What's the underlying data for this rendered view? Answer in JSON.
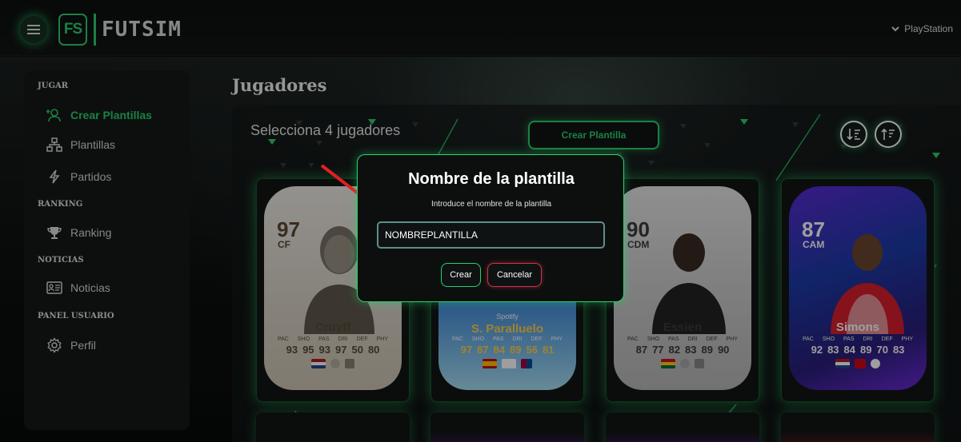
{
  "header": {
    "logo_mark": "FS",
    "app_name": "FUTSIM",
    "platform": "PlayStation"
  },
  "sidebar": {
    "sections": [
      {
        "title": "JUGAR",
        "items": [
          {
            "label": "Crear Plantillas",
            "icon": "add-user-icon",
            "active": true
          },
          {
            "label": "Plantillas",
            "icon": "hierarchy-icon"
          },
          {
            "label": "Partidos",
            "icon": "lightning-icon"
          }
        ]
      },
      {
        "title": "RANKING",
        "items": [
          {
            "label": "Ranking",
            "icon": "trophy-icon"
          }
        ]
      },
      {
        "title": "NOTICIAS",
        "items": [
          {
            "label": "Noticias",
            "icon": "news-icon"
          }
        ]
      },
      {
        "title": "PANEL USUARIO",
        "items": [
          {
            "label": "Perfil",
            "icon": "gear-icon"
          }
        ]
      }
    ]
  },
  "main": {
    "title": "Jugadores",
    "select_label": "Selecciona 4 jugadores",
    "create_button": "Crear Plantilla",
    "sort_icons": [
      "sort-desc-icon",
      "sort-asc-icon"
    ]
  },
  "cards": [
    {
      "rating": "97",
      "position": "CF",
      "name": "Cruyff",
      "stat_labels": [
        "PAC",
        "SHO",
        "PAS",
        "DRI",
        "DEF",
        "PHY"
      ],
      "stats": [
        "93",
        "95",
        "93",
        "97",
        "50",
        "80"
      ]
    },
    {
      "rating": "",
      "position": "",
      "name": "S. Paralluelo",
      "sponsor": "Spotify",
      "stat_labels": [
        "PAC",
        "SHO",
        "PAS",
        "DRI",
        "DEF",
        "PHY"
      ],
      "stats": [
        "97",
        "87",
        "84",
        "89",
        "56",
        "81"
      ]
    },
    {
      "rating": "90",
      "position": "CDM",
      "name": "Essien",
      "stat_labels": [
        "PAC",
        "SHO",
        "PAS",
        "DRI",
        "DEF",
        "PHY"
      ],
      "stats": [
        "87",
        "77",
        "82",
        "83",
        "89",
        "90"
      ]
    },
    {
      "rating": "87",
      "position": "CAM",
      "name": "Simons",
      "stat_labels": [
        "PAC",
        "SHO",
        "PAS",
        "DRI",
        "DEF",
        "PHY"
      ],
      "stats": [
        "92",
        "83",
        "84",
        "89",
        "70",
        "83"
      ]
    }
  ],
  "modal": {
    "title": "Nombre de la plantilla",
    "subtitle": "Introduce el nombre de la plantilla",
    "input_value": "NOMBREPLANTILLA",
    "confirm_label": "Crear",
    "cancel_label": "Cancelar"
  },
  "colors": {
    "accent": "#2bd16c",
    "cancel": "#d0334a",
    "arrow": "#e02020"
  }
}
